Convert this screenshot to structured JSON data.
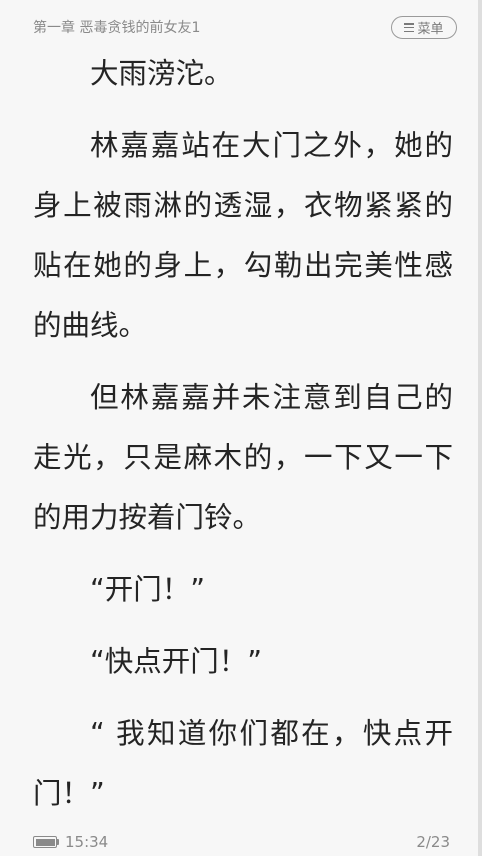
{
  "header": {
    "chapter_title": "第一章 恶毒贪钱的前女友1",
    "menu_label": "菜单",
    "menu_icon": "hamburger-icon"
  },
  "content": {
    "paragraphs": [
      "大雨滂沱。",
      "林嘉嘉站在大门之外，她的身上被雨淋的透湿，衣物紧紧的贴在她的身上，勾勒出完美性感的曲线。",
      "但林嘉嘉并未注意到自己的走光，只是麻木的，一下又一下的用力按着门铃。",
      "“开门！”",
      "“快点开门！”",
      "“ 我知道你们都在，快点开门！”"
    ]
  },
  "footer": {
    "battery_level": 1.0,
    "time": "15:34",
    "page": "2/23"
  },
  "colors": {
    "background": "#f7f7f7",
    "text": "#242424",
    "muted": "#8a8a8a"
  }
}
